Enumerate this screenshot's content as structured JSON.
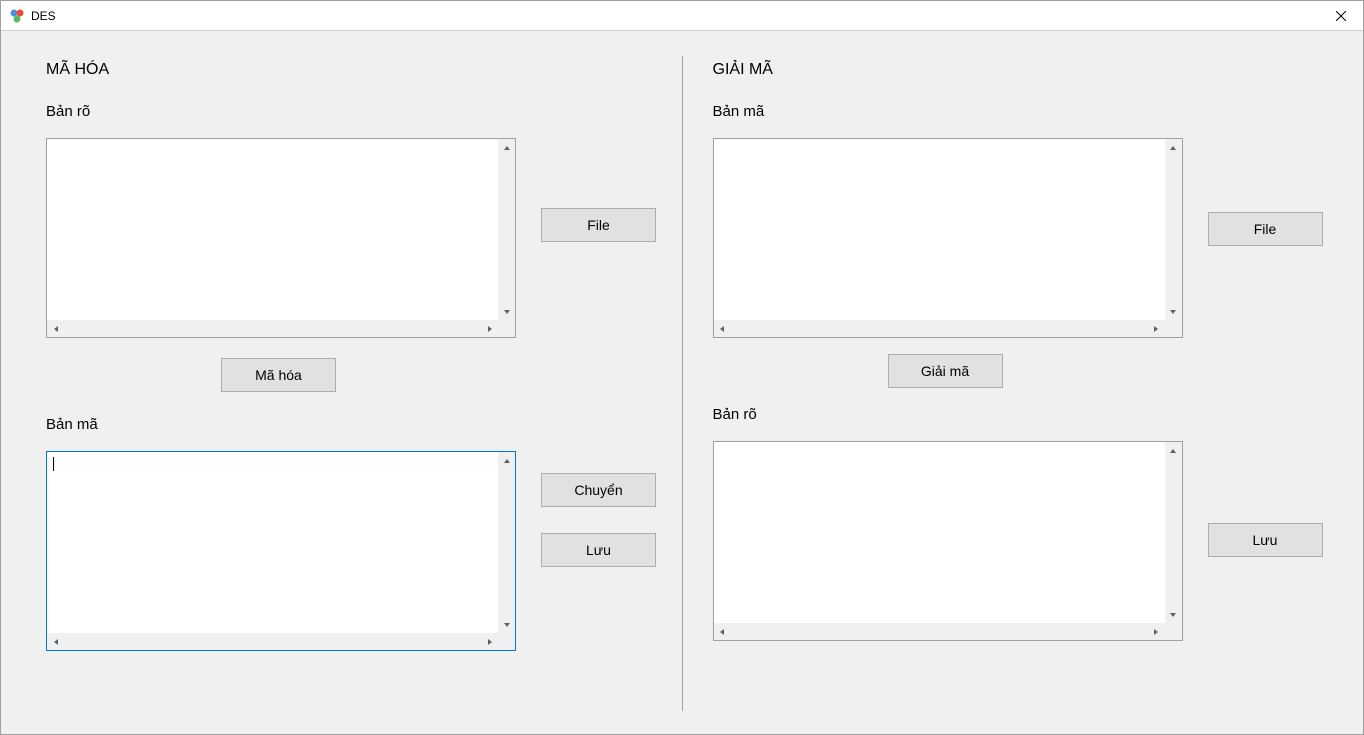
{
  "window": {
    "title": "DES"
  },
  "encrypt": {
    "heading": "MÃ HÓA",
    "plaintext_label": "Bản rõ",
    "plaintext_value": "",
    "file_button": "File",
    "encrypt_button": "Mã hóa",
    "ciphertext_label": "Bản mã",
    "ciphertext_value": "",
    "transfer_button": "Chuyển",
    "save_button": "Lưu"
  },
  "decrypt": {
    "heading": "GIẢI MÃ",
    "ciphertext_label": "Bản mã",
    "ciphertext_value": "",
    "file_button": "File",
    "decrypt_button": "Giải mã",
    "plaintext_label": "Bản rõ",
    "plaintext_value": "",
    "save_button": "Lưu"
  }
}
